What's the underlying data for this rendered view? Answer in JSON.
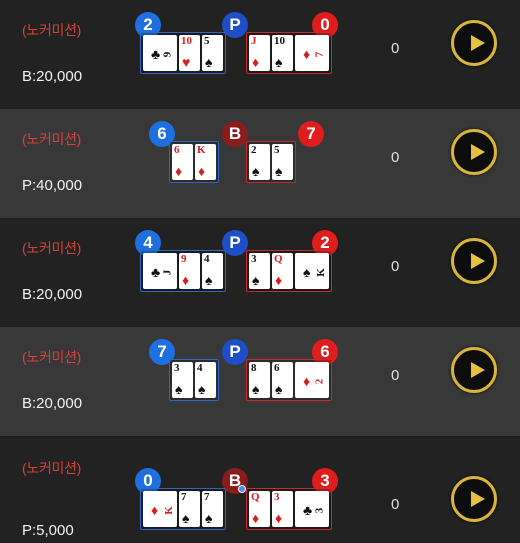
{
  "no_commission_label": "(노커미션)",
  "play_icon": "play-icon",
  "rows": [
    {
      "bet": "B:20,000",
      "amount": "0",
      "player_score": "2",
      "center": "P",
      "banker_score": "0",
      "center_color": "#1e4fc8",
      "player_cards": [
        {
          "rank": "9",
          "suit": "♣",
          "color": "black",
          "rot": true
        },
        {
          "rank": "10",
          "suit": "♥",
          "color": "red"
        },
        {
          "rank": "5",
          "suit": "♠",
          "color": "black"
        }
      ],
      "banker_cards": [
        {
          "rank": "J",
          "suit": "♦",
          "color": "red"
        },
        {
          "rank": "10",
          "suit": "♠",
          "color": "black"
        },
        {
          "rank": "7",
          "suit": "♦",
          "color": "red",
          "rot": true
        }
      ]
    },
    {
      "bet": "P:40,000",
      "amount": "0",
      "player_score": "6",
      "center": "B",
      "banker_score": "7",
      "center_color": "#8a1c1c",
      "player_cards": [
        {
          "rank": "6",
          "suit": "♦",
          "color": "red"
        },
        {
          "rank": "K",
          "suit": "♦",
          "color": "red"
        }
      ],
      "banker_cards": [
        {
          "rank": "2",
          "suit": "♠",
          "color": "black"
        },
        {
          "rank": "5",
          "suit": "♠",
          "color": "black"
        }
      ]
    },
    {
      "bet": "B:20,000",
      "amount": "0",
      "player_score": "4",
      "center": "P",
      "banker_score": "2",
      "center_color": "#1e4fc8",
      "player_cards": [
        {
          "rank": "J",
          "suit": "♣",
          "color": "black",
          "rot": true
        },
        {
          "rank": "9",
          "suit": "♦",
          "color": "red"
        },
        {
          "rank": "4",
          "suit": "♠",
          "color": "black"
        }
      ],
      "banker_cards": [
        {
          "rank": "3",
          "suit": "♠",
          "color": "black"
        },
        {
          "rank": "Q",
          "suit": "♦",
          "color": "red"
        },
        {
          "rank": "K",
          "suit": "♠",
          "color": "black",
          "rot": true
        }
      ]
    },
    {
      "bet": "B:20,000",
      "amount": "0",
      "player_score": "7",
      "center": "P",
      "banker_score": "6",
      "center_color": "#1e4fc8",
      "player_cards": [
        {
          "rank": "3",
          "suit": "♠",
          "color": "black"
        },
        {
          "rank": "4",
          "suit": "♠",
          "color": "black"
        }
      ],
      "banker_cards": [
        {
          "rank": "8",
          "suit": "♠",
          "color": "black"
        },
        {
          "rank": "6",
          "suit": "♠",
          "color": "black"
        },
        {
          "rank": "2",
          "suit": "♦",
          "color": "red",
          "rot": true
        }
      ]
    },
    {
      "bet": "P:5,000",
      "amount": "0",
      "player_score": "0",
      "center": "B",
      "banker_score": "3",
      "center_color": "#8a1c1c",
      "player_cards": [
        {
          "rank": "K",
          "suit": "♦",
          "color": "red",
          "rot": true
        },
        {
          "rank": "7",
          "suit": "♠",
          "color": "black"
        },
        {
          "rank": "7",
          "suit": "♠",
          "color": "black"
        }
      ],
      "banker_cards": [
        {
          "rank": "Q",
          "suit": "♦",
          "color": "red"
        },
        {
          "rank": "3",
          "suit": "♦",
          "color": "red"
        },
        {
          "rank": "3",
          "suit": "♣",
          "color": "black",
          "rot": true
        }
      ]
    }
  ]
}
